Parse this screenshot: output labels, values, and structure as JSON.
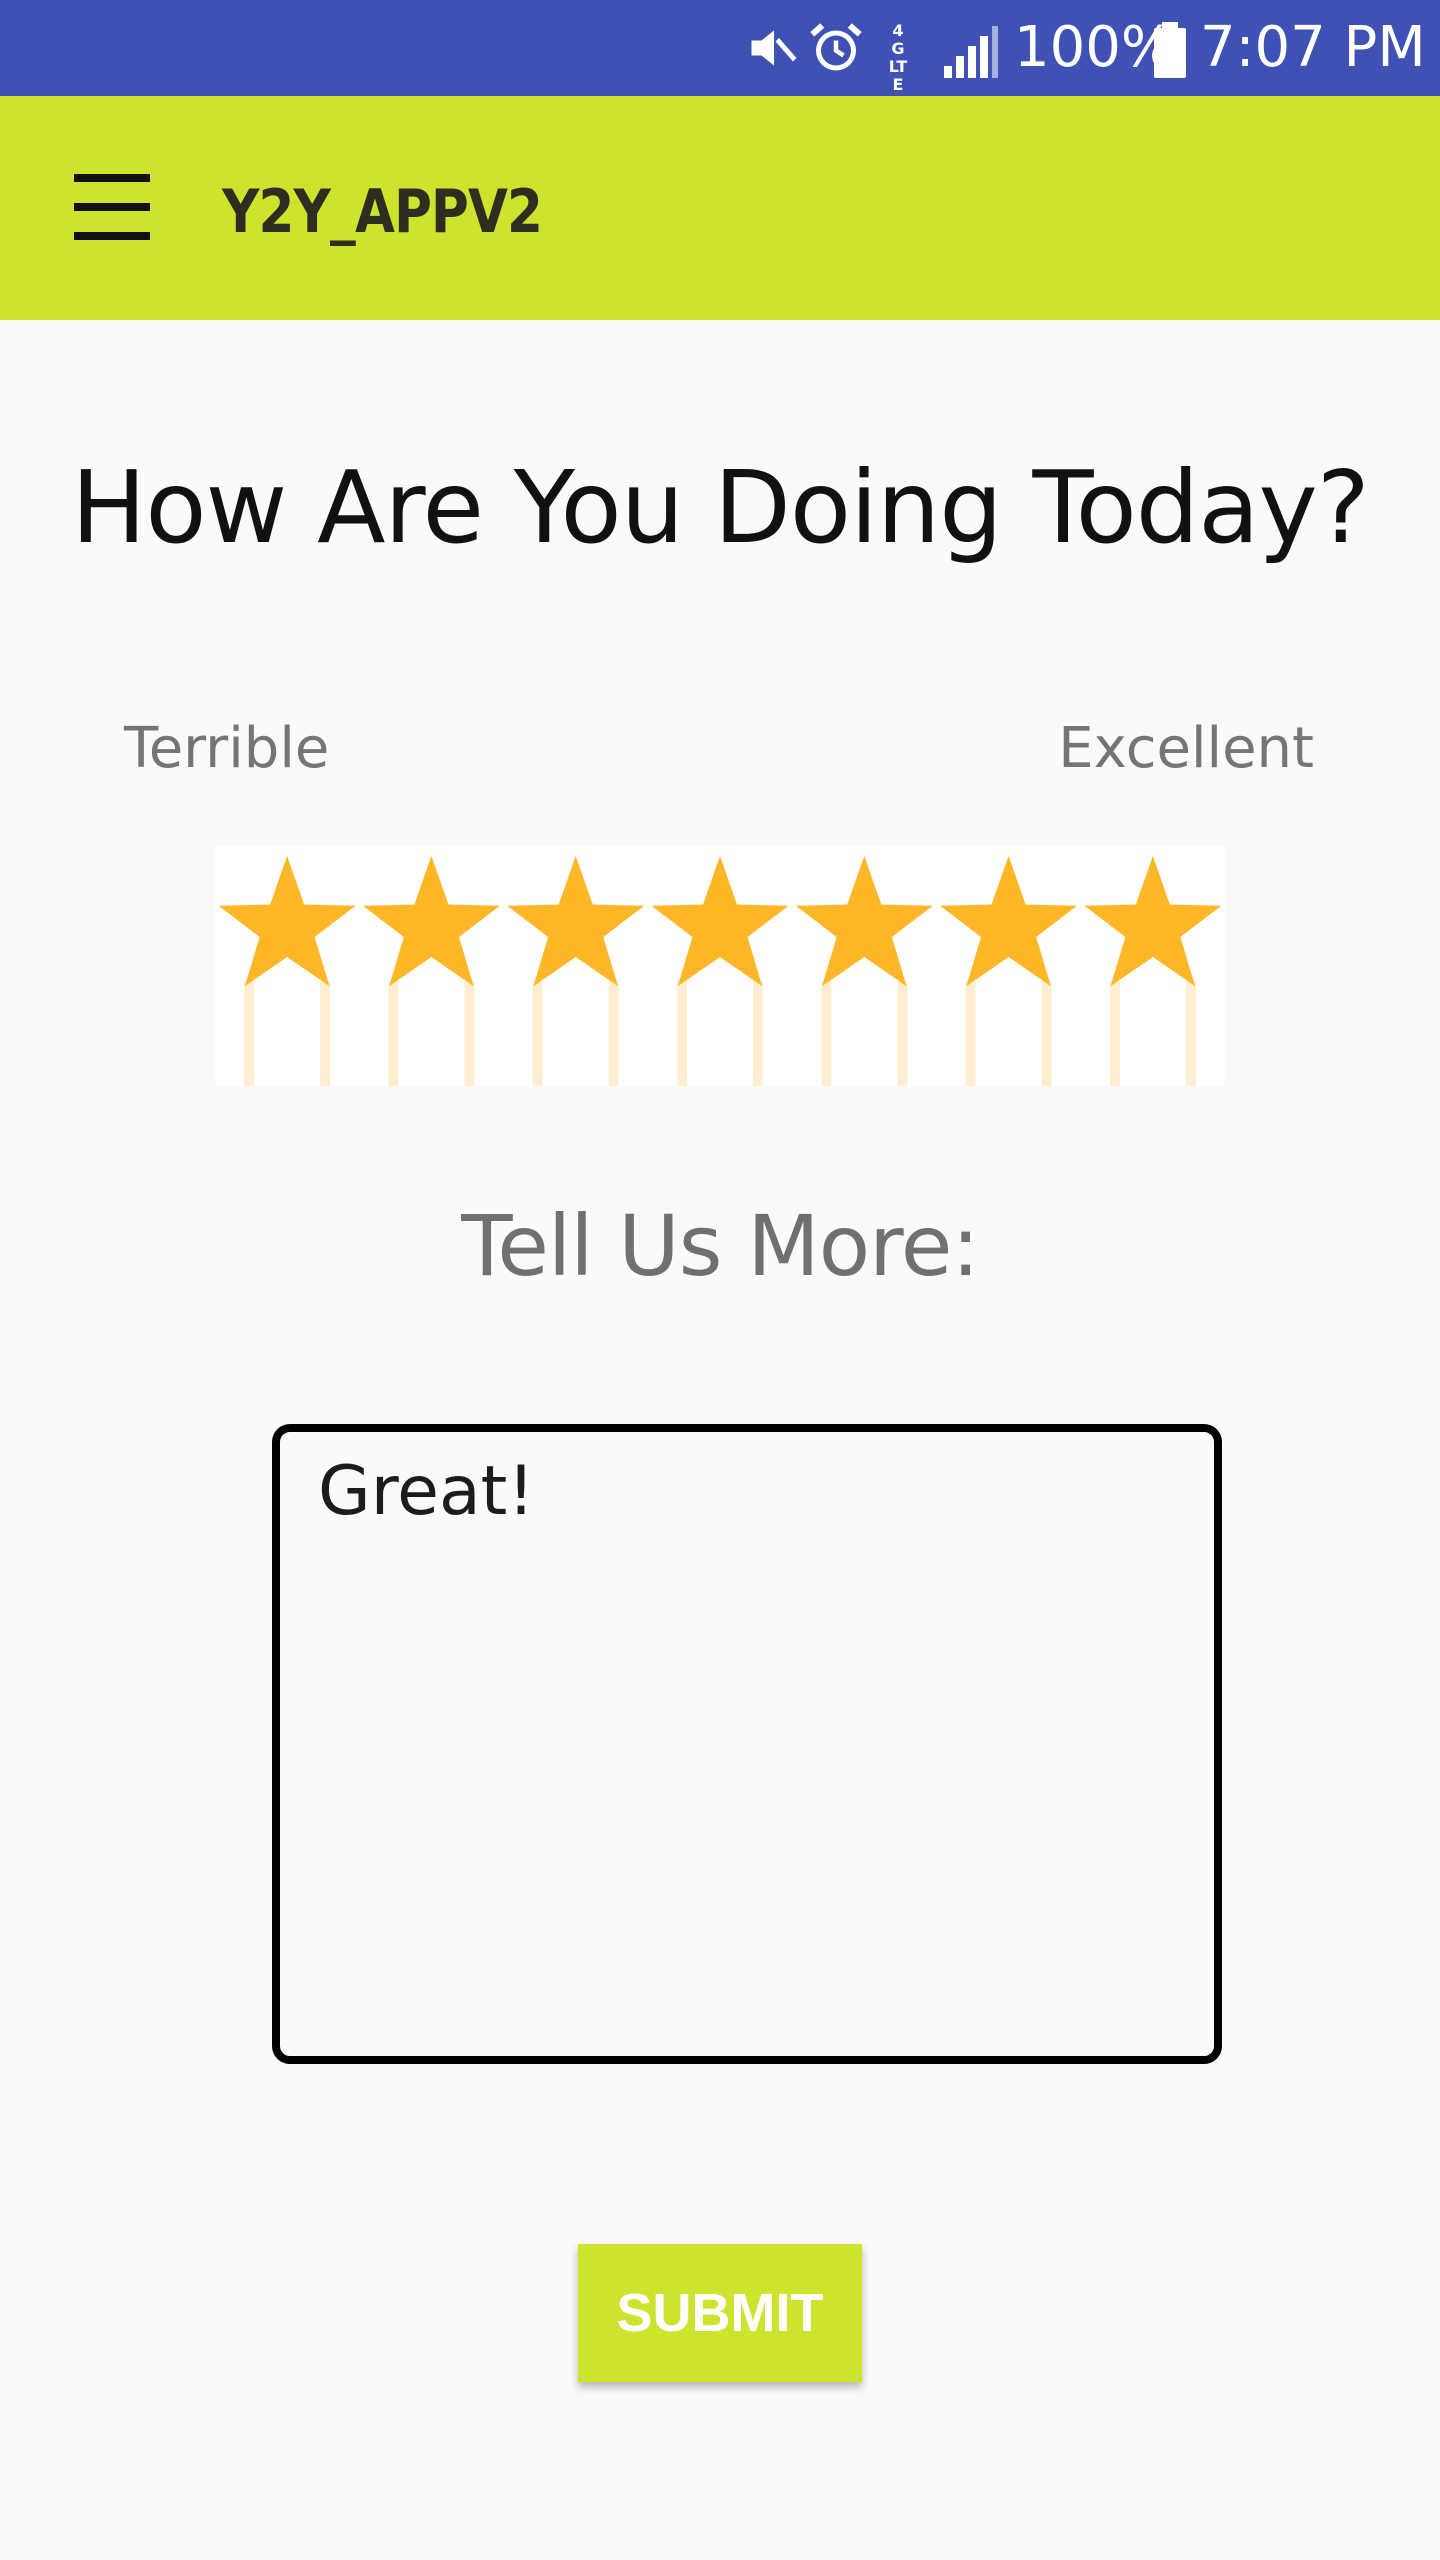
{
  "status_bar": {
    "battery_percent_text": "100%",
    "time": "7:07 PM",
    "network_label": "4G LTE",
    "icons": [
      "mute-icon",
      "alarm-icon",
      "network-4g-lte-icon",
      "signal-icon",
      "battery-icon"
    ],
    "background_color": "#3f51b5"
  },
  "app_bar": {
    "title": "Y2Y_APPV2",
    "menu_icon": "hamburger-menu-icon",
    "background_color": "#cde32e"
  },
  "rating": {
    "question": "How Are You Doing Today?",
    "min_label": "Terrible",
    "max_label": "Excellent",
    "max_stars": 7,
    "selected_stars": 7,
    "star_color": "#ffb627"
  },
  "feedback": {
    "section_title": "Tell Us More:",
    "value": "Great!",
    "placeholder": ""
  },
  "actions": {
    "submit_label": "SUBMIT",
    "submit_color": "#cde32e"
  }
}
